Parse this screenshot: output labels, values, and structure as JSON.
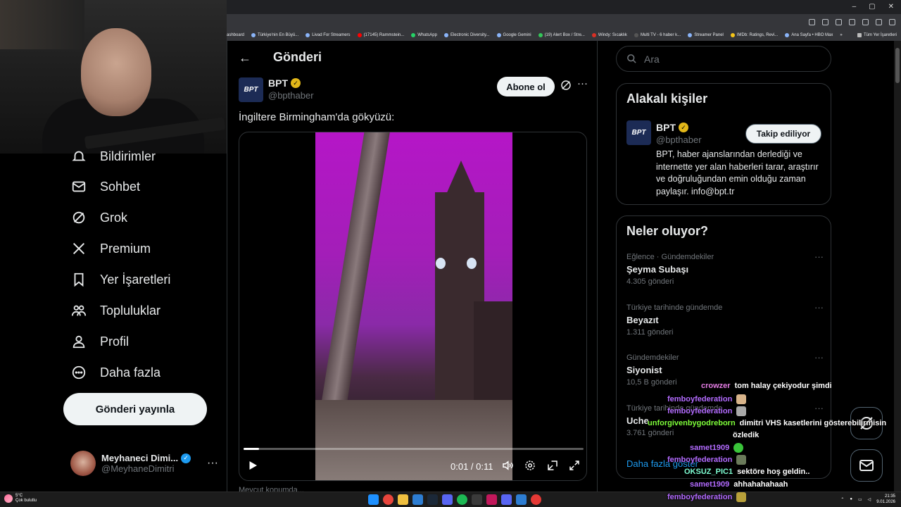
{
  "window_controls": [
    "–",
    "▢",
    "✕"
  ],
  "bookmarks": [
    "ashboard",
    "Türkiye'nin En Büyü...",
    "Livad For Streamers",
    "(17145) Rammstein...",
    "WhatsApp",
    "Electronic Diversity...",
    "Google Gemini",
    "(19) Alert Box / Stre...",
    "Windy: Sıcaklık",
    "Multi TV - 6 haber k...",
    "Streamer Panel",
    "IMDb: Ratings, Revi...",
    "Ana Sayfa • HBO Max",
    "»"
  ],
  "bookmarks_all": "Tüm Yer İşaretleri",
  "nav": {
    "items": [
      {
        "label": "Bildirimler",
        "icon": "bell-icon"
      },
      {
        "label": "Sohbet",
        "icon": "mail-icon"
      },
      {
        "label": "Grok",
        "icon": "grok-icon"
      },
      {
        "label": "Premium",
        "icon": "x-logo-icon"
      },
      {
        "label": "Yer İşaretleri",
        "icon": "bookmark-icon"
      },
      {
        "label": "Topluluklar",
        "icon": "communities-icon"
      },
      {
        "label": "Profil",
        "icon": "person-icon"
      },
      {
        "label": "Daha fazla",
        "icon": "more-circle-icon"
      }
    ],
    "post_button": "Gönderi yayınla"
  },
  "account": {
    "name": "Meyhaneci Dimi...",
    "handle": "@MeyhaneDimitri",
    "more": "···"
  },
  "main": {
    "back": "←",
    "title": "Gönderi",
    "author": {
      "avatar": "BPT",
      "name": "BPT",
      "handle": "@bpthaber"
    },
    "subscribe": "Abone ol",
    "more": "···",
    "text": "İngiltere Birmingham'da gökyüzü:",
    "video": {
      "progress": 0.045,
      "time": "0:01 / 0:11"
    },
    "below_text": "Mevcut konumda..."
  },
  "search": {
    "placeholder": "Ara"
  },
  "related": {
    "title": "Alakalı kişiler",
    "person": {
      "avatar": "BPT",
      "name": "BPT",
      "handle": "@bpthaber",
      "follow": "Takip ediliyor",
      "bio": "BPT, haber ajanslarından derlediği ve internette yer alan haberleri tarar, araştırır ve doğruluğundan emin olduğu zaman paylaşır. info@bpt.tr"
    }
  },
  "trends": {
    "title": "Neler oluyor?",
    "items": [
      {
        "category": "Eğlence · Gündemdekiler",
        "title": "Şeyma Subaşı",
        "count": "4.305 gönderi"
      },
      {
        "category": "Türkiye tarihinde gündemde",
        "title": "Beyazıt",
        "count": "1.311 gönderi"
      },
      {
        "category": "Gündemdekiler",
        "title": "Siyonist",
        "count": "10,5 B gönderi"
      },
      {
        "category": "Türkiye tarihinde gündemde",
        "title": "Uche",
        "count": "3.761 gönderi"
      }
    ],
    "more": "···",
    "show_more": "Daha fazla göster"
  },
  "chat": [
    {
      "user": "crowzer",
      "color": "#e67ee6",
      "message": "tom halay çekiyodur şimdi"
    },
    {
      "user": "femboyfederation",
      "color": "#b36bff",
      "message": ""
    },
    {
      "user": "femboyfederation",
      "color": "#b36bff",
      "message": ""
    },
    {
      "user": "unforgivenbygodreborn",
      "color": "#7fff3a",
      "message": "dimitri VHS kasetlerini gösterebilirmisin"
    },
    {
      "user": "",
      "color": "#ffffff",
      "message": "özledik"
    },
    {
      "user": "samet1909",
      "color": "#b36bff",
      "message": ""
    },
    {
      "user": "femboyfederation",
      "color": "#b36bff",
      "message": ""
    },
    {
      "user": "OKSUZ_PIC1",
      "color": "#7fffd4",
      "message": "sektöre hoş geldin.."
    },
    {
      "user": "samet1909",
      "color": "#b36bff",
      "message": "ahhahahahaah"
    },
    {
      "user": "femboyfederation",
      "color": "#b36bff",
      "message": ""
    }
  ],
  "taskbar": {
    "weather_temp": "5°C",
    "weather_desc": "Çok bulutlu",
    "time": "21:35",
    "date": "9.01.2026"
  },
  "colors": {
    "accent": "#1d9bf0",
    "verified_gold": "#e2b719",
    "sky_purple": "#b516c7"
  }
}
